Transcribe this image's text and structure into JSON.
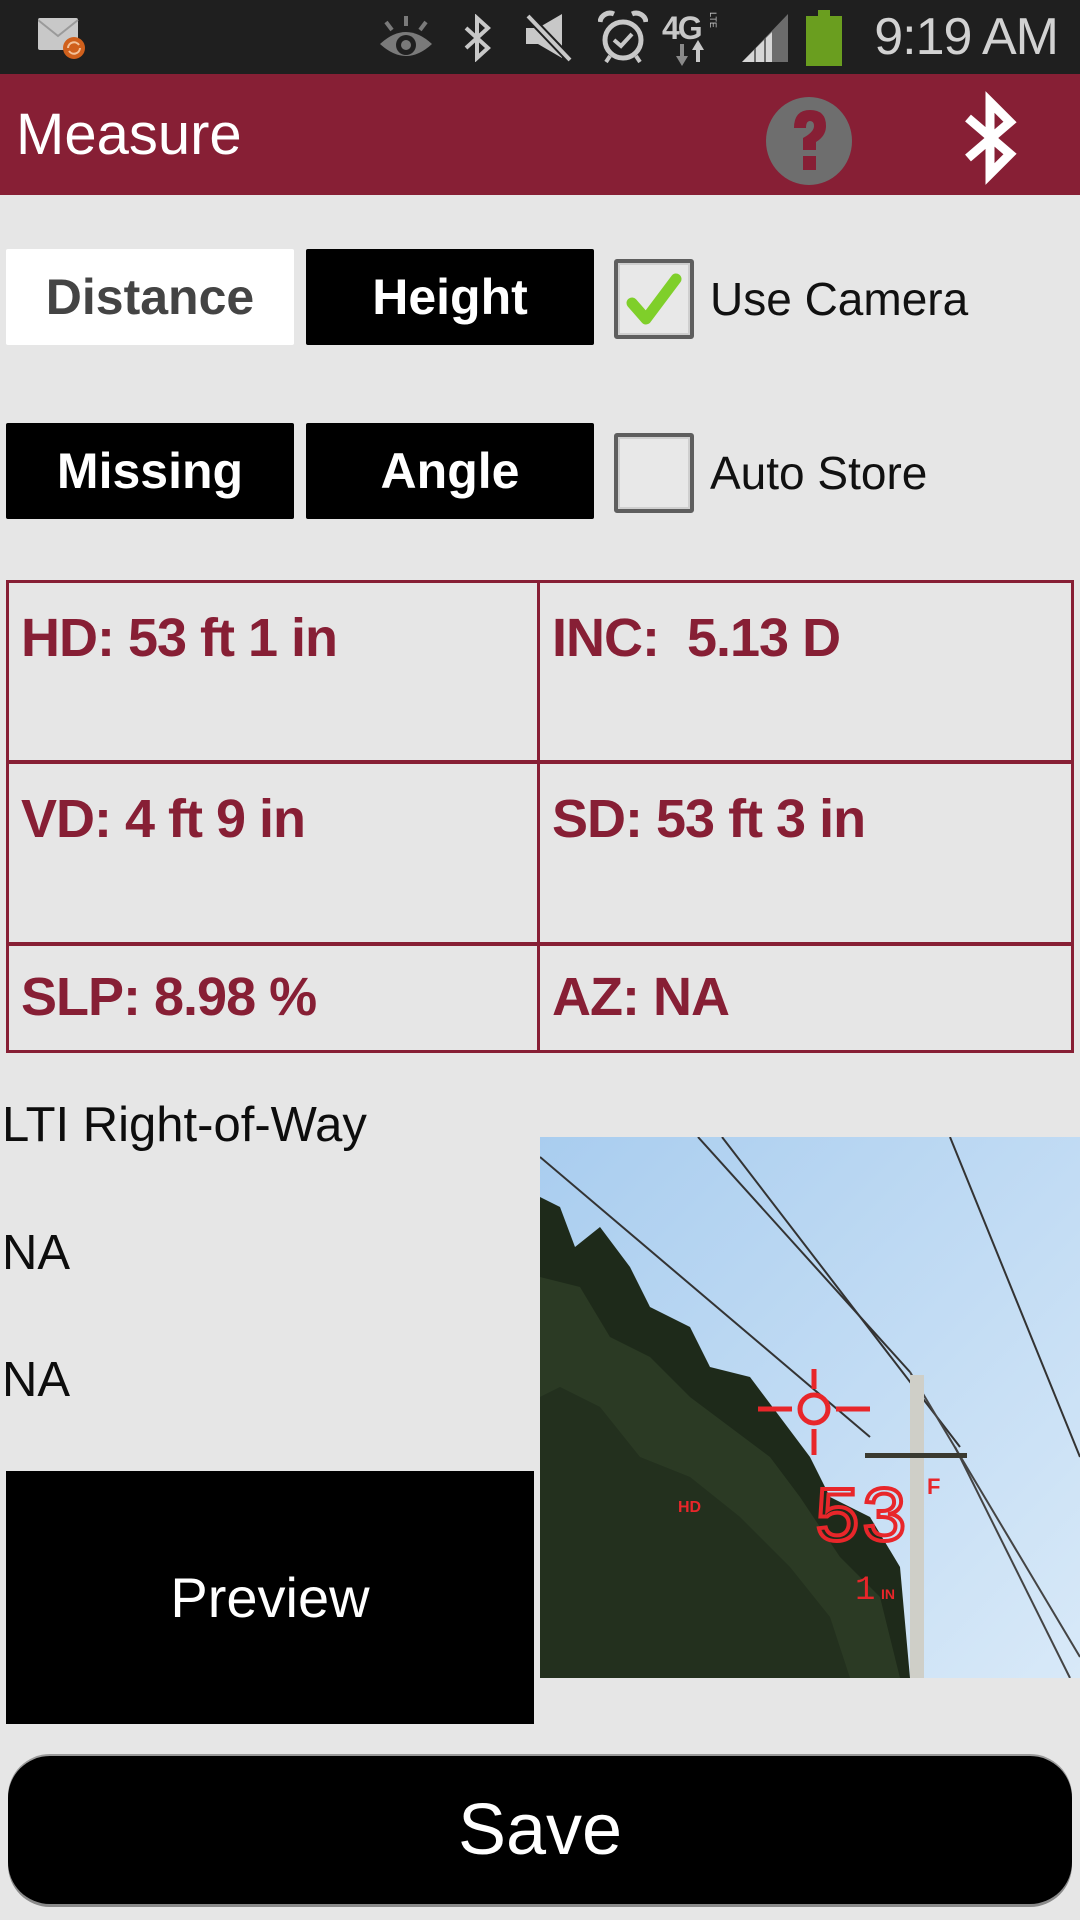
{
  "status_bar": {
    "time": "9:19 AM",
    "network_label": "4G",
    "network_sub": "LTE",
    "icons": [
      "email-sync-icon",
      "eye-icon",
      "bluetooth-icon",
      "mute-icon",
      "alarm-icon",
      "4g-lte-icon",
      "signal-icon",
      "battery-icon"
    ],
    "battery_level": 1.0,
    "battery_color": "#6a9e1f"
  },
  "action_bar": {
    "title": "Measure",
    "help_icon": "help-icon",
    "bluetooth_icon": "bluetooth-icon",
    "color": "#871f35"
  },
  "modes": [
    {
      "label": "Distance",
      "active": true
    },
    {
      "label": "Height",
      "active": false
    },
    {
      "label": "Missing",
      "active": false
    },
    {
      "label": "Angle",
      "active": false
    }
  ],
  "options": {
    "use_camera": {
      "label": "Use Camera",
      "checked": true
    },
    "auto_store": {
      "label": "Auto Store",
      "checked": false
    }
  },
  "readings": [
    {
      "label": "HD:",
      "value": "53 ft 1 in",
      "text": "HD: 53 ft 1 in"
    },
    {
      "label": "INC:",
      "value": "5.13 D",
      "text": "INC:  5.13 D"
    },
    {
      "label": "VD:",
      "value": "4 ft 9 in",
      "text": "VD: 4 ft 9 in"
    },
    {
      "label": "SD:",
      "value": "53 ft 3 in",
      "text": "SD: 53 ft 3 in"
    },
    {
      "label": "SLP:",
      "value": "8.98 %",
      "text": "SLP: 8.98 %"
    },
    {
      "label": "AZ:",
      "value": "NA",
      "text": "AZ: NA"
    }
  ],
  "info": {
    "project": "LTI Right-of-Way",
    "line2": "NA",
    "line3": "NA"
  },
  "camera_overlay": {
    "mode_label": "HD",
    "big_value": "53",
    "big_unit": "F",
    "small_value": "1",
    "small_unit": "IN"
  },
  "buttons": {
    "preview": "Preview",
    "save": "Save"
  }
}
